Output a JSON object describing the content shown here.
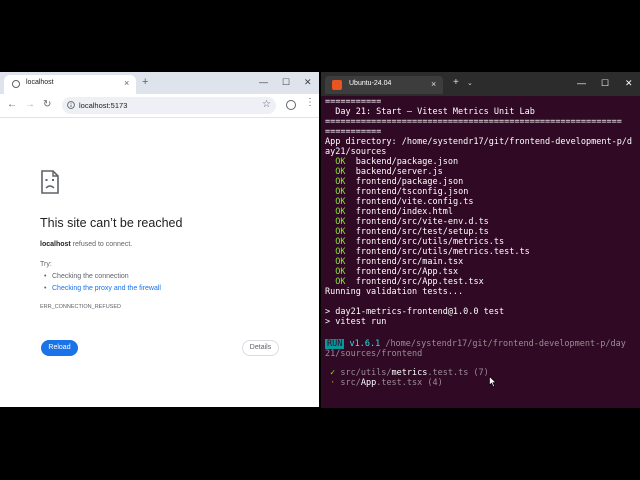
{
  "browser": {
    "tab_title": "localhost",
    "tab_close": "×",
    "new_tab": "+",
    "win_min": "—",
    "win_max": "☐",
    "win_close": "✕",
    "back": "←",
    "forward": "→",
    "reload": "↻",
    "url": "localhost:5173",
    "star": "☆",
    "menu": "⋮",
    "error": {
      "title": "This site can’t be reached",
      "host": "localhost",
      "desc_suffix": " refused to connect.",
      "try_label": "Try:",
      "suggestions": [
        "Checking the connection",
        "Checking the proxy and the firewall"
      ],
      "code": "ERR_CONNECTION_REFUSED",
      "reload_label": "Reload",
      "details_label": "Details"
    }
  },
  "terminal": {
    "tab_title": "Ubuntu-24.04",
    "tab_close": "×",
    "new_tab": "+",
    "dropdown": "⌄",
    "win_min": "—",
    "win_max": "☐",
    "win_close": "✕",
    "lines": {
      "rule_top": "===========",
      "heading": "  Day 21: Start – Vitest Metrics Unit Lab",
      "rule_long": "==========================================================",
      "rule_short": "===========",
      "app_dir_1": "App directory: /home/systendr17/git/frontend-development-p/d",
      "app_dir_2": "ay21/sources",
      "check_status": "OK",
      "checks": [
        "backend/package.json",
        "backend/server.js",
        "frontend/package.json",
        "frontend/tsconfig.json",
        "frontend/vite.config.ts",
        "frontend/index.html",
        "frontend/src/vite-env.d.ts",
        "frontend/src/test/setup.ts",
        "frontend/src/utils/metrics.ts",
        "frontend/src/utils/metrics.test.ts",
        "frontend/src/main.tsx",
        "frontend/src/App.tsx",
        "frontend/src/App.test.tsx"
      ],
      "running": "Running validation tests...",
      "cmd1": "> day21-metrics-frontend@1.0.0 test",
      "cmd2": "> vitest run",
      "run_badge": "RUN",
      "vitest_version": "v1.6.1",
      "run_path_1": " /home/systendr17/git/frontend-development-p/day",
      "run_path_2": "21/sources/frontend",
      "test1_mark": "✓",
      "test1_dir": " src/utils/",
      "test1_file": "metrics",
      "test1_rest": ".test.ts (7)",
      "test2_mark": "·",
      "test2_dir": " src/",
      "test2_file": "App",
      "test2_rest": ".test.tsx (4)"
    }
  },
  "colors": {
    "terminal_bg": "#300a24",
    "ok_green": "#8ae234",
    "prompt_cyan": "#34e2e2",
    "run_badge": "#06989a",
    "link_blue": "#1a73e8",
    "ubuntu_orange": "#e95420"
  },
  "icons": {
    "sad_page": "sad-document-icon",
    "omnibox": "info-icon",
    "profile": "profile-icon",
    "terminal_tab": "ubuntu-icon"
  }
}
